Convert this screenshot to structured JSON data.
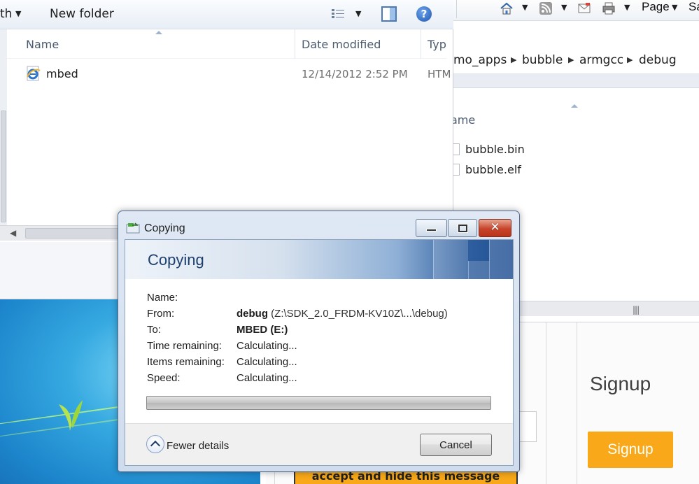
{
  "background_explorer": {
    "toolbar": {
      "partial_label": "th",
      "new_folder_label": "New folder"
    },
    "columns": {
      "name": "Name",
      "date_modified": "Date modified",
      "type": "Typ"
    },
    "files": [
      {
        "name": "mbed",
        "date_modified": "12/14/2012 2:52 PM",
        "type": "HTM"
      }
    ]
  },
  "right_explorer": {
    "ie_toolbar": {
      "page_label": "Page",
      "partial_label": "Sa"
    },
    "breadcrumb": [
      "mo_apps",
      "bubble",
      "armgcc",
      "debug"
    ],
    "column_name": "ame",
    "files": [
      "bubble.bin",
      "bubble.elf"
    ]
  },
  "webpage": {
    "signup_title": "Signup",
    "signup_button": "Signup",
    "accept_banner": "accept and hide this message"
  },
  "dialog": {
    "window_title": "Copying",
    "heading": "Copying",
    "details": [
      {
        "label": "Name:",
        "value_bold": "",
        "value": ""
      },
      {
        "label": "From:",
        "value_bold": "debug",
        "value": " (Z:\\SDK_2.0_FRDM-KV10Z\\...\\debug)"
      },
      {
        "label": "To:",
        "value_bold": "MBED (E:)",
        "value": ""
      },
      {
        "label": "Time remaining:",
        "value_bold": "",
        "value": "Calculating..."
      },
      {
        "label": "Items remaining:",
        "value_bold": "",
        "value": "Calculating..."
      },
      {
        "label": "Speed:",
        "value_bold": "",
        "value": "Calculating..."
      }
    ],
    "progress_fraction": 0,
    "fewer_details_label": "Fewer details",
    "cancel_label": "Cancel"
  },
  "colors": {
    "accent_orange": "#f8a818",
    "close_red": "#c7442a",
    "banner_blue": "#1e4f92"
  },
  "icons": [
    "ie-file-icon",
    "view-options-icon",
    "preview-pane-icon",
    "help-icon",
    "home-icon",
    "rss-icon",
    "read-mail-icon",
    "print-icon",
    "copy-progress-icon",
    "collapse-chevron-icon",
    "file-icon"
  ]
}
